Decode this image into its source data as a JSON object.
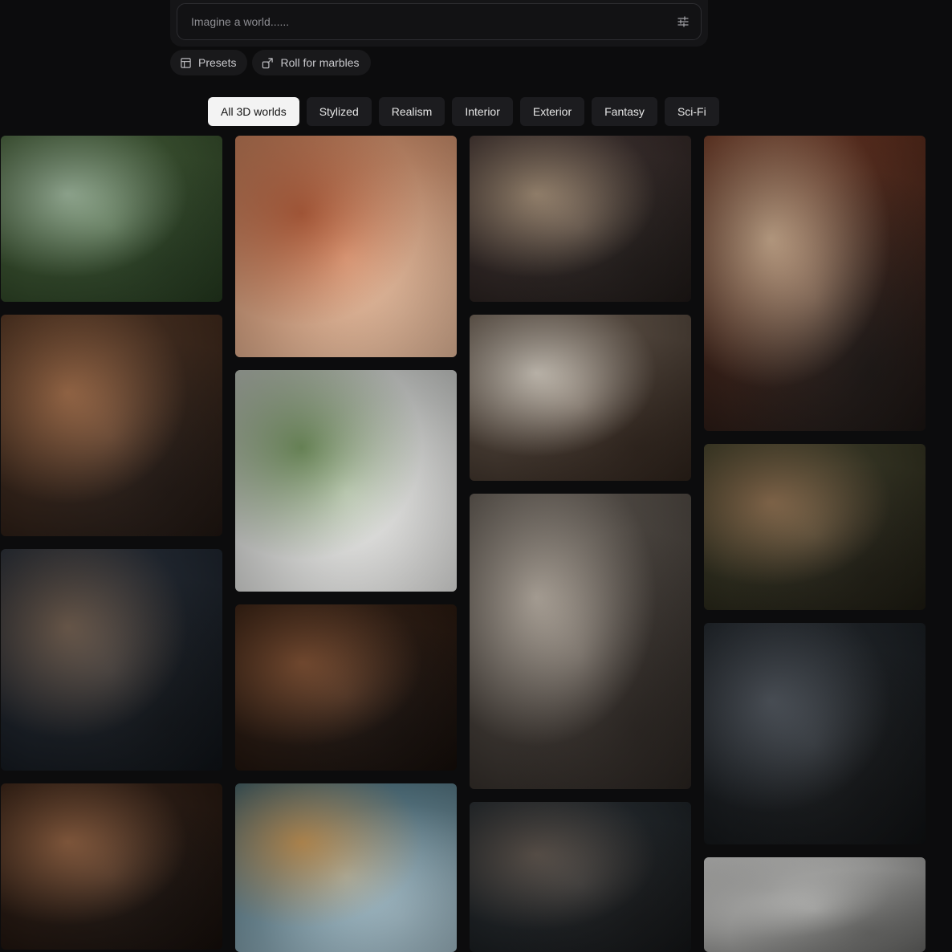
{
  "prompt": {
    "placeholder": "Imagine a world......",
    "settings_icon": "sliders-icon"
  },
  "actions": [
    {
      "label": "Presets",
      "icon": "layout-icon"
    },
    {
      "label": "Roll for marbles",
      "icon": "share-dice-icon"
    }
  ],
  "filters": [
    {
      "label": "All 3D worlds",
      "active": true
    },
    {
      "label": "Stylized",
      "active": false
    },
    {
      "label": "Realism",
      "active": false
    },
    {
      "label": "Interior",
      "active": false
    },
    {
      "label": "Exterior",
      "active": false
    },
    {
      "label": "Fantasy",
      "active": false
    },
    {
      "label": "Sci-Fi",
      "active": false
    }
  ],
  "gallery": [
    {
      "name": "forest-treehouse-world",
      "colors": [
        "#4d6b3e",
        "#9bb59a",
        "#243a1e"
      ]
    },
    {
      "name": "library-hall-world",
      "colors": [
        "#5a3a26",
        "#a06a45",
        "#1f1510"
      ]
    },
    {
      "name": "spaceship-bedroom-world",
      "colors": [
        "#2a3340",
        "#6e5a4a",
        "#0d1116"
      ]
    },
    {
      "name": "log-cabin-world",
      "colors": [
        "#3a2418",
        "#8a5a3a",
        "#140c08"
      ]
    },
    {
      "name": "palace-courtyard-world",
      "colors": [
        "#e0946b",
        "#b45a36",
        "#f2c3a2"
      ]
    },
    {
      "name": "zen-garden-world",
      "colors": [
        "#d8dbd8",
        "#6f8f5a",
        "#f4f4f2"
      ]
    },
    {
      "name": "wooden-kitchen-world",
      "colors": [
        "#3c2416",
        "#7a4a2c",
        "#140c08"
      ]
    },
    {
      "name": "whimsical-room-world",
      "colors": [
        "#3f6a7a",
        "#c09050",
        "#a9c4d0"
      ]
    },
    {
      "name": "cozy-study-world",
      "colors": [
        "#4a3a38",
        "#a08a72",
        "#1e1816"
      ]
    },
    {
      "name": "loft-corridor-world",
      "colors": [
        "#7a6a5c",
        "#d0c8bc",
        "#2e221a"
      ]
    },
    {
      "name": "cave-bedroom-world",
      "colors": [
        "#6a625a",
        "#b8aea2",
        "#2a2420"
      ]
    },
    {
      "name": "classroom-world",
      "colors": [
        "#2a3238",
        "#5a5048",
        "#121416"
      ]
    },
    {
      "name": "victorian-staircase-world",
      "colors": [
        "#7a3a24",
        "#c8a88a",
        "#1a1412"
      ]
    },
    {
      "name": "overgrown-ruins-world",
      "colors": [
        "#4a4a30",
        "#8a6a4a",
        "#1c1a10"
      ]
    },
    {
      "name": "dark-parlor-world",
      "colors": [
        "#242a30",
        "#4a5058",
        "#0e1012"
      ]
    },
    {
      "name": "sketch-house-world",
      "colors": [
        "#f2f2f0",
        "#b0b0ae",
        "#6a6a68"
      ]
    }
  ]
}
